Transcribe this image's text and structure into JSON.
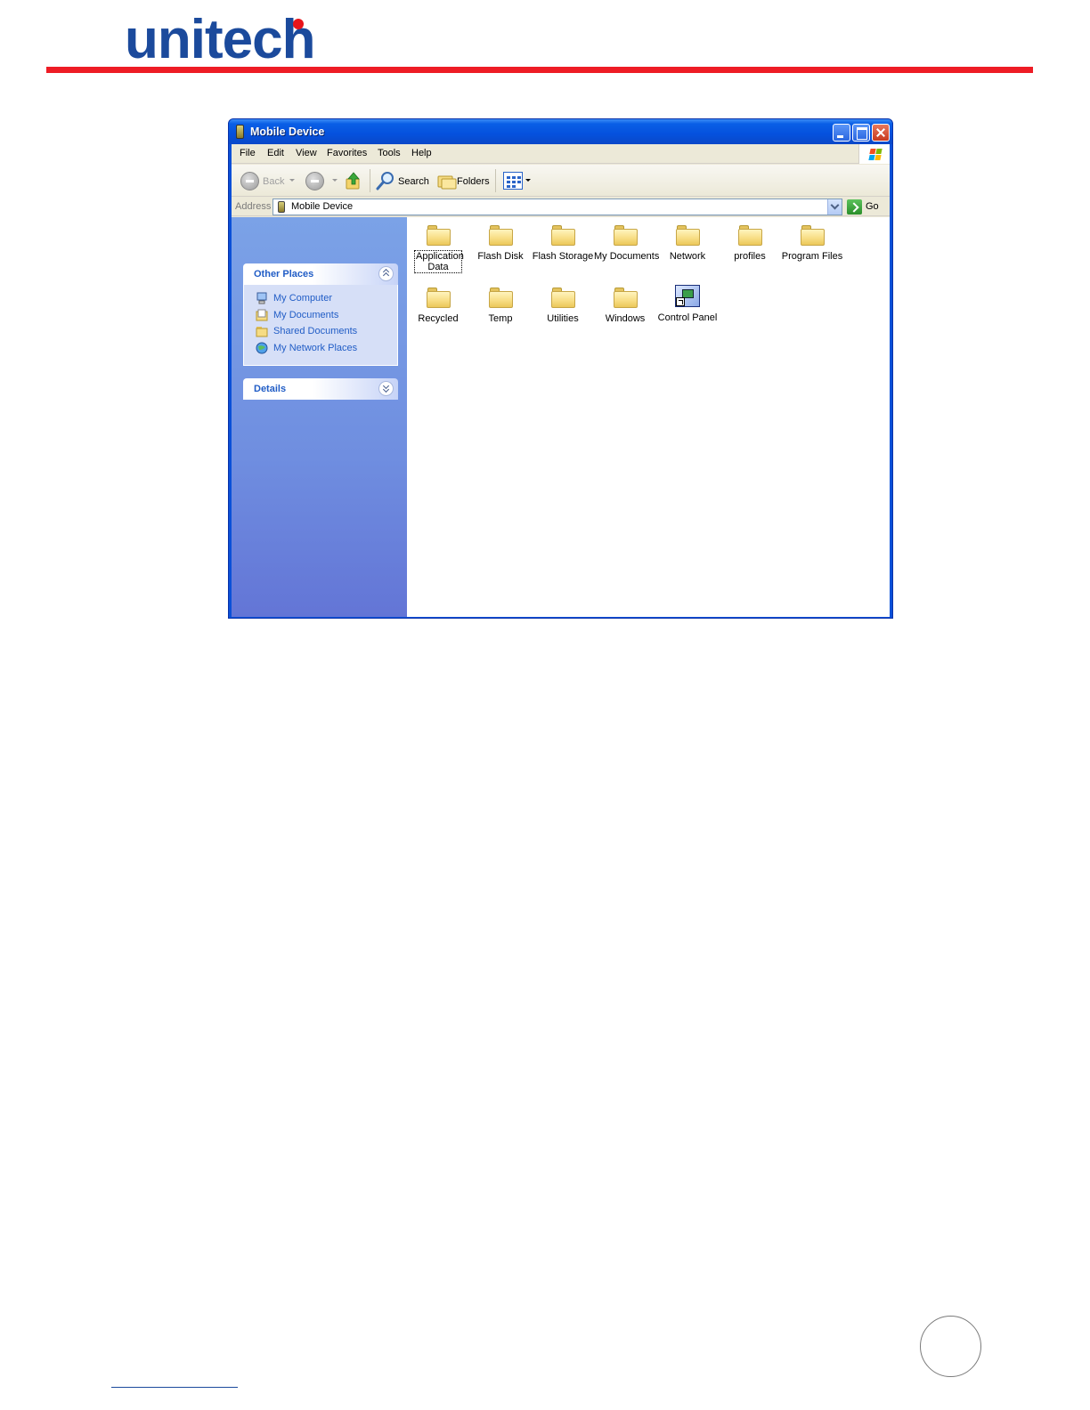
{
  "document": {
    "logo_text": "unitech",
    "brand_colors": {
      "logo": "#1b4a9c",
      "rule": "#ee1c25"
    }
  },
  "window": {
    "title": "Mobile Device",
    "menu": [
      "File",
      "Edit",
      "View",
      "Favorites",
      "Tools",
      "Help"
    ],
    "toolbar": {
      "back_label": "Back",
      "search_label": "Search",
      "folders_label": "Folders"
    },
    "address": {
      "label": "Address",
      "value": "Mobile Device",
      "go_label": "Go"
    },
    "task_pane": {
      "other_places": {
        "title": "Other Places",
        "links": [
          {
            "label": "My Computer",
            "icon": "my-computer-icon"
          },
          {
            "label": "My Documents",
            "icon": "my-documents-icon"
          },
          {
            "label": "Shared Documents",
            "icon": "shared-documents-icon"
          },
          {
            "label": "My Network Places",
            "icon": "network-places-icon"
          }
        ]
      },
      "details": {
        "title": "Details"
      }
    },
    "items": [
      {
        "label": "Application Data",
        "icon": "folder-icon",
        "selected": true
      },
      {
        "label": "Flash Disk",
        "icon": "folder-icon"
      },
      {
        "label": "Flash Storage",
        "icon": "folder-icon"
      },
      {
        "label": "My Documents",
        "icon": "folder-icon"
      },
      {
        "label": "Network",
        "icon": "folder-icon"
      },
      {
        "label": "profiles",
        "icon": "folder-icon"
      },
      {
        "label": "Program Files",
        "icon": "folder-icon"
      },
      {
        "label": "Recycled",
        "icon": "folder-icon"
      },
      {
        "label": "Temp",
        "icon": "folder-icon"
      },
      {
        "label": "Utilities",
        "icon": "folder-icon"
      },
      {
        "label": "Windows",
        "icon": "folder-icon"
      },
      {
        "label": "Control Panel",
        "icon": "control-panel-shortcut-icon"
      }
    ]
  }
}
